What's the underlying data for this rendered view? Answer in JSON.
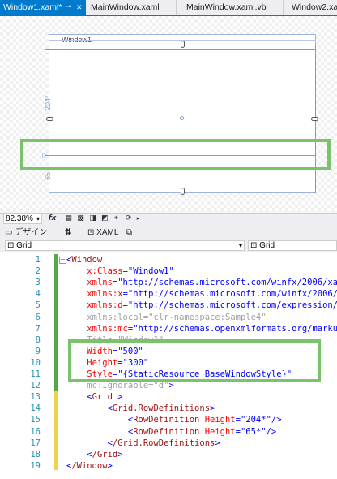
{
  "tabs": [
    {
      "label": "Window1.xaml*",
      "pin": "⊸",
      "close": "✕",
      "active": true
    },
    {
      "label": "MainWindow.xaml",
      "active": false
    },
    {
      "label": "MainWindow.xaml.vb",
      "active": false
    },
    {
      "label": "Window2.xa",
      "active": false
    }
  ],
  "designer": {
    "window_title": "Window1",
    "row1_height": "204*",
    "row2_height": "65"
  },
  "zoom": {
    "value": "82.38%",
    "value_caret": "▾",
    "fx": "fx"
  },
  "view_tabs": {
    "design": "デザイン",
    "swap": "⇅",
    "xaml": "XAML"
  },
  "scope": {
    "left": "Grid",
    "right": "Grid"
  },
  "colors": {
    "accent": "#007acc",
    "highlight": "#7ac36a"
  },
  "code": {
    "line_numbers": [
      "1",
      "2",
      "3",
      "4",
      "5",
      "6",
      "7",
      "8",
      "9",
      "10",
      "11",
      "12",
      "13",
      "14",
      "15",
      "16",
      "17",
      "18",
      "19"
    ],
    "lines": [
      "<Window",
      "    x:Class=\"Window1\"",
      "    xmlns=\"http://schemas.microsoft.com/winfx/2006/xa",
      "    xmlns:x=\"http://schemas.microsoft.com/winfx/2006/",
      "    xmlns:d=\"http://schemas.microsoft.com/expression/",
      "    xmlns:local=\"clr-namespace:Sample4\"",
      "    xmlns:mc=\"http://schemas.openxmlformats.org/marku",
      "    Title=\"Window1\"",
      "    Width=\"500\"",
      "    Height=\"300\"",
      "    Style=\"{StaticResource BaseWindowStyle}\"",
      "    mc:Ignorable=\"d\">",
      "    <Grid >",
      "        <Grid.RowDefinitions>",
      "            <RowDefinition Height=\"204*\"/>",
      "            <RowDefinition Height=\"65*\"/>",
      "        </Grid.RowDefinitions>",
      "    </Grid>",
      "</Window>"
    ]
  }
}
